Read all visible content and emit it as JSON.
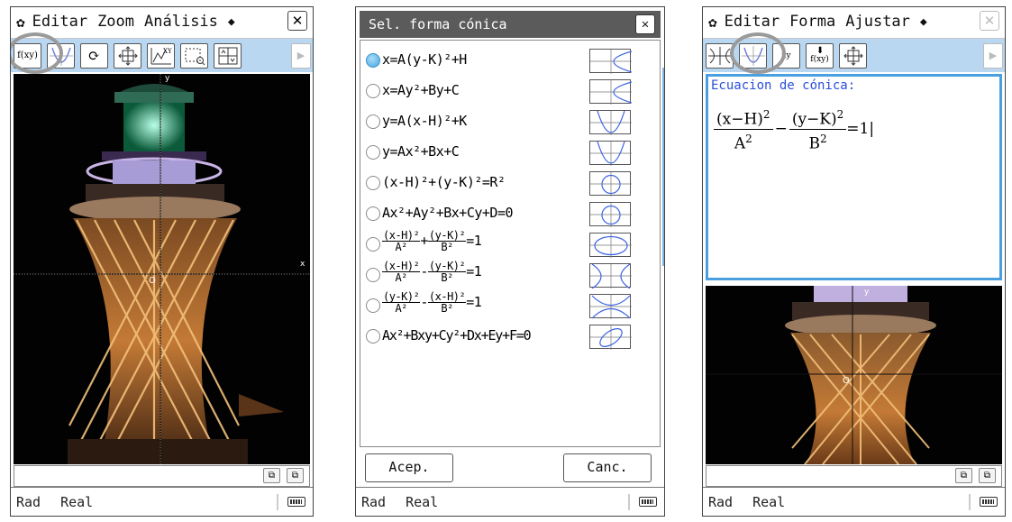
{
  "screen1": {
    "menu": [
      "Editar",
      "Zoom",
      "Análisis"
    ],
    "toolbar_fxy_label": "f(xy)",
    "graph_labels": {
      "y": "y",
      "origin": "O",
      "x": "x"
    },
    "status": [
      "Rad",
      "Real"
    ]
  },
  "screen2": {
    "dialog_title": "Sel. forma cónica",
    "options": [
      {
        "text": "x=A(y-K)²+H",
        "selected": true
      },
      {
        "text": "x=Ay²+By+C",
        "selected": false
      },
      {
        "text": "y=A(x-H)²+K",
        "selected": false
      },
      {
        "text": "y=Ax²+Bx+C",
        "selected": false
      },
      {
        "text": "(x-H)²+(y-K)²=R²",
        "selected": false
      },
      {
        "text": "Ax²+Ay²+Bx+Cy+D=0",
        "selected": false
      },
      {
        "num1": "(x-H)²",
        "den1": "A²",
        "op": "+",
        "num2": "(y-K)²",
        "den2": "B²",
        "rhs": "=1",
        "selected": false
      },
      {
        "num1": "(x-H)²",
        "den1": "A²",
        "op": "-",
        "num2": "(y-K)²",
        "den2": "B²",
        "rhs": "=1",
        "selected": false
      },
      {
        "num1": "(y-K)²",
        "den1": "A²",
        "op": "-",
        "num2": "(x-H)²",
        "den2": "B²",
        "rhs": "=1",
        "selected": false
      },
      {
        "text": "Ax²+Bxy+Cy²+Dx+Ey+F=0",
        "selected": false
      }
    ],
    "ok_label": "Acep.",
    "cancel_label": "Canc.",
    "status": [
      "Rad",
      "Real"
    ]
  },
  "screen3": {
    "menu": [
      "Editar",
      "Forma",
      "Ajustar"
    ],
    "editor_title": "Ecuacion de cónica:",
    "formula": {
      "num1": "(x−H)",
      "exp1": "2",
      "den1": "A",
      "dexp1": "2",
      "op": "−",
      "num2": "(y−K)",
      "exp2": "2",
      "den2": "B",
      "dexp2": "2",
      "rhs": "=1|"
    },
    "toolbar_xy_label": "xy",
    "toolbar_fxy_label": "f(xy)",
    "graph_labels": {
      "y": "y",
      "origin": "O"
    },
    "status": [
      "Rad",
      "Real"
    ]
  },
  "colors": {
    "toolbar": "#b9d7f1",
    "dialog_title": "#5b5b5b",
    "selected_radio": "#46a7e4",
    "editor_border": "#4a9fe0",
    "editor_title": "#2b4fd9"
  }
}
